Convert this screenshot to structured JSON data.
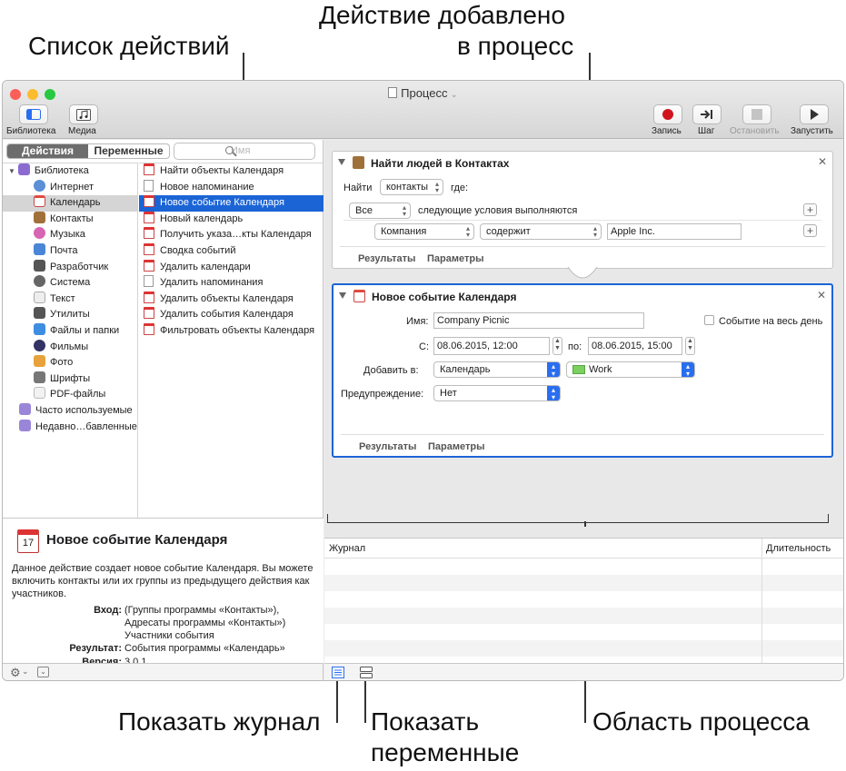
{
  "callouts": {
    "actions_list": "Список действий",
    "action_added_1": "Действие добавлено",
    "action_added_2": "в процесс",
    "show_log": "Показать журнал",
    "show_vars_1": "Показать",
    "show_vars_2": "переменные",
    "workflow_area": "Область процесса"
  },
  "window": {
    "title": "Процесс",
    "traffic_colors": [
      "#fc5f57",
      "#fdbc2e",
      "#28c840"
    ]
  },
  "toolbar": {
    "library_label": "Библиотека",
    "media_label": "Медиа",
    "record_label": "Запись",
    "step_label": "Шаг",
    "stop_label": "Остановить",
    "run_label": "Запустить"
  },
  "left": {
    "tab_actions": "Действия",
    "tab_variables": "Переменные",
    "search_placeholder": "Имя",
    "library": [
      {
        "label": "Библиотека",
        "icon": "library-icon",
        "color": "#8c6bd1"
      },
      {
        "label": "Интернет",
        "icon": "globe-icon",
        "color": "#5b8fd6"
      },
      {
        "label": "Календарь",
        "icon": "calendar-icon",
        "color": "#e04a3f"
      },
      {
        "label": "Контакты",
        "icon": "contacts-icon",
        "color": "#a0703a"
      },
      {
        "label": "Музыка",
        "icon": "music-icon",
        "color": "#d765b3"
      },
      {
        "label": "Почта",
        "icon": "mail-icon",
        "color": "#4a86d8"
      },
      {
        "label": "Разработчик",
        "icon": "developer-icon",
        "color": "#555555"
      },
      {
        "label": "Система",
        "icon": "system-icon",
        "color": "#666666"
      },
      {
        "label": "Текст",
        "icon": "text-icon",
        "color": "#aaaaaa"
      },
      {
        "label": "Утилиты",
        "icon": "utilities-icon",
        "color": "#555555"
      },
      {
        "label": "Файлы и папки",
        "icon": "finder-icon",
        "color": "#3f8de0"
      },
      {
        "label": "Фильмы",
        "icon": "movies-icon",
        "color": "#333366"
      },
      {
        "label": "Фото",
        "icon": "photos-icon",
        "color": "#e7a23b"
      },
      {
        "label": "Шрифты",
        "icon": "fonts-icon",
        "color": "#777777"
      },
      {
        "label": "PDF-файлы",
        "icon": "pdf-icon",
        "color": "#bbbbbb"
      },
      {
        "label": "Часто используемые",
        "icon": "smart-folder-icon",
        "color": "#9a86d8"
      },
      {
        "label": "Недавно…бавленные",
        "icon": "smart-folder-icon",
        "color": "#9a86d8"
      }
    ],
    "actions": [
      "Найти объекты Календаря",
      "Новое напоминание",
      "Новое событие Календаря",
      "Новый календарь",
      "Получить указа…кты Календаря",
      "Сводка событий",
      "Удалить календари",
      "Удалить напоминания",
      "Удалить объекты Календаря",
      "Удалить события Календаря",
      "Фильтровать объекты Календаря"
    ]
  },
  "description": {
    "title": "Новое событие Календаря",
    "icon_day": "17",
    "text": "Данное действие создает новое событие Календаря. Вы можете включить контакты или их группы из предыдущего действия как участников.",
    "input_key": "Вход:",
    "input_val": "(Группы программы «Контакты»), Адресаты программы «Контакты») Участники события",
    "result_key": "Результат:",
    "result_val": "События программы «Календарь»",
    "version_key": "Версия:",
    "version_val": "3.0.1"
  },
  "card1": {
    "title": "Найти людей в Контактах",
    "find_label": "Найти",
    "find_value": "контакты",
    "where_label": "где:",
    "all_value": "Все",
    "conditions_label": "следующие условия выполняются",
    "field_value": "Компания",
    "op_value": "содержит",
    "text_value": "Apple Inc.",
    "results_tab": "Результаты",
    "params_tab": "Параметры"
  },
  "card2": {
    "title": "Новое событие Календаря",
    "name_label": "Имя:",
    "name_value": "Company Picnic",
    "allday_label": "Событие на весь день",
    "from_label": "С:",
    "from_value": "08.06.2015, 12:00",
    "to_label": "по:",
    "to_value": "08.06.2015, 15:00",
    "add_label": "Добавить в:",
    "add_value": "Календарь",
    "calendar_value": "Work",
    "calendar_color": "#7bd05f",
    "alert_label": "Предупреждение:",
    "alert_value": "Нет",
    "results_tab": "Результаты",
    "params_tab": "Параметры"
  },
  "log": {
    "col_log": "Журнал",
    "col_duration": "Длительность"
  }
}
